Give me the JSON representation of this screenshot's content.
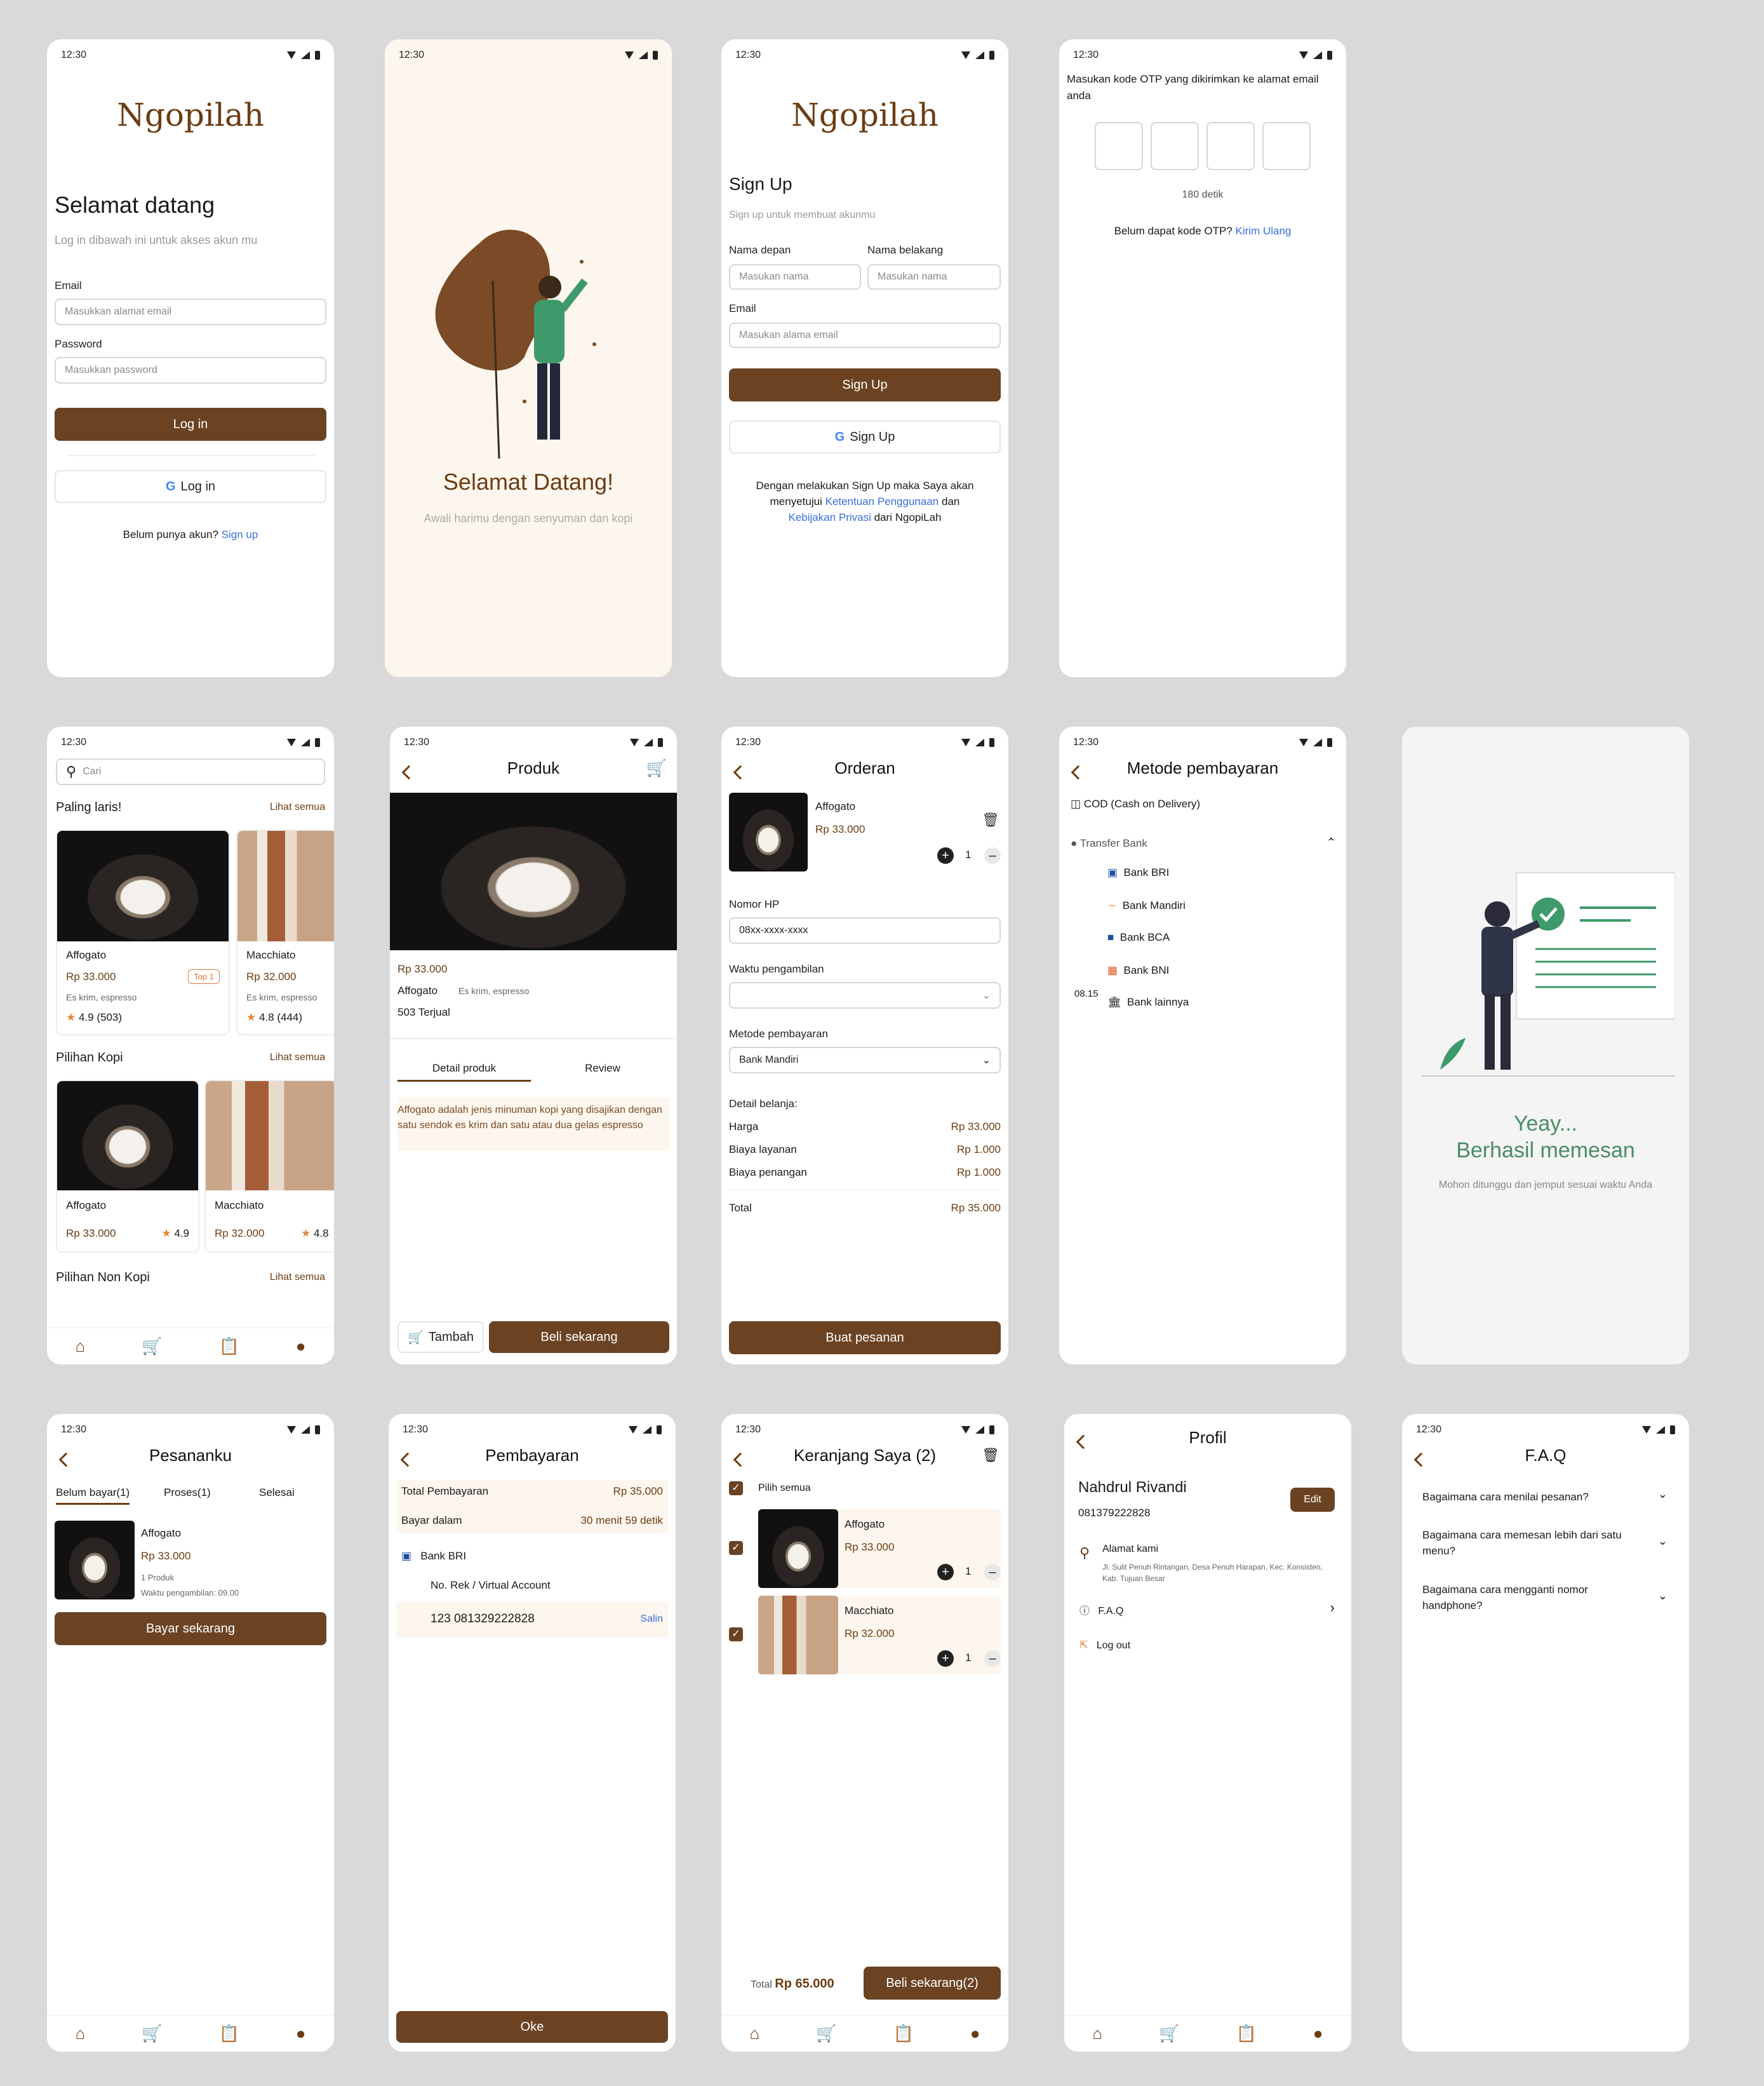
{
  "status": {
    "time": "12:30"
  },
  "login": {
    "logo": "Ngopilah",
    "title": "Selamat datang",
    "subtitle": "Log in dibawah ini untuk akses akun mu",
    "email_label": "Email",
    "email_placeholder": "Masukkan alamat email",
    "password_label": "Password",
    "password_placeholder": "Masukkan password",
    "login_btn": "Log in",
    "google_btn": "Log in",
    "no_account": "Belum punya akun?",
    "signup_link": "Sign up"
  },
  "splash": {
    "title": "Selamat Datang!",
    "subtitle": "Awali harimu dengan senyuman dan kopi"
  },
  "signup": {
    "logo": "Ngopilah",
    "title": "Sign Up",
    "subtitle": "Sign up untuk membuat akunmu",
    "first_label": "Nama depan",
    "first_placeholder": "Masukan nama",
    "last_label": "Nama belakang",
    "last_placeholder": "Masukan nama",
    "email_label": "Email",
    "email_placeholder": "Masukan alama email",
    "btn": "Sign Up",
    "google_btn": "Sign Up",
    "terms_1": "Dengan melakukan Sign Up maka Saya akan",
    "terms_2": "menyetujui",
    "terms_link1": "Ketentuan Penggunaan",
    "terms_3": "dan",
    "terms_link2": "Kebijakan Privasi",
    "terms_4": "dari NgopiLah"
  },
  "otp": {
    "instruction": "Masukan kode OTP yang dikirimkan ke alamat email anda",
    "timer": "180 detik",
    "resend_text": "Belum dapat kode OTP?",
    "resend_link": "Kirim Ulang"
  },
  "home": {
    "search_placeholder": "Cari",
    "section1": "Paling laris!",
    "section2": "Pilihan Kopi",
    "section3": "Pilihan Non Kopi",
    "see_all": "Lihat semua",
    "best": [
      {
        "name": "Affogato",
        "price": "Rp 33.000",
        "badge": "Top 1",
        "desc": "Es krim, espresso",
        "rating": "4.9 (503)"
      },
      {
        "name": "Macchiato",
        "price": "Rp 32.000",
        "desc": "Es krim, espresso",
        "rating": "4.8 (444)"
      }
    ],
    "coffee": [
      {
        "name": "Affogato",
        "price": "Rp 33.000",
        "rating": "4.9"
      },
      {
        "name": "Macchiato",
        "price": "Rp 32.000",
        "rating": "4.8"
      }
    ]
  },
  "product": {
    "title": "Produk",
    "price": "Rp 33.000",
    "name": "Affogato",
    "desc": "Es krim, espresso",
    "sold": "503 Terjual",
    "tab1": "Detail produk",
    "tab2": "Review",
    "detail": "Affogato adalah jenis minuman kopi yang disajikan dengan satu sendok es krim dan satu atau dua gelas espresso",
    "add": "Tambah",
    "buy": "Beli sekarang"
  },
  "order": {
    "title": "Orderan",
    "item_name": "Affogato",
    "item_price": "Rp 33.000",
    "qty": "1",
    "phone_label": "Nomor HP",
    "phone_value": "08xx-xxxx-xxxx",
    "time_label": "Waktu pengambilan",
    "time_value": "",
    "pay_label": "Metode pembayaran",
    "pay_value": "Bank Mandiri",
    "detail_label": "Detail belanja:",
    "rows": [
      {
        "k": "Harga",
        "v": "Rp 33.000"
      },
      {
        "k": "Biaya layanan",
        "v": "Rp 1.000"
      },
      {
        "k": "Biaya penangan",
        "v": "Rp 1.000"
      }
    ],
    "total_label": "Total",
    "total_value": "Rp 35.000",
    "btn": "Buat pesanan"
  },
  "payment_method": {
    "title": "Metode pembayaran",
    "cod": "COD (Cash on Delivery)",
    "transfer": "Transfer Bank",
    "banks": [
      "Bank BRI",
      "Bank Mandiri",
      "Bank BCA",
      "Bank BNI",
      "Bank lainnya"
    ],
    "time": "08.15"
  },
  "success": {
    "title1": "Yeay...",
    "title2": "Berhasil memesan",
    "subtitle": "Mohon ditunggu dan jemput sesuai waktu Anda"
  },
  "myorders": {
    "title": "Pesananku",
    "tab1": "Belum bayar(1)",
    "tab2": "Proses(1)",
    "tab3": "Selesai",
    "item_name": "Affogato",
    "item_price": "Rp 33.000",
    "item_qty": "1 Produk",
    "item_time": "Waktu pengambilan: 09.00",
    "btn": "Bayar sekarang"
  },
  "paying": {
    "title": "Pembayaran",
    "total_label": "Total Pembayaran",
    "total_value": "Rp 35.000",
    "within_label": "Bayar dalam",
    "within_value": "30 menit 59 detik",
    "bank": "Bank BRI",
    "va_label": "No. Rek / Virtual Account",
    "va_value": "123  081329222828",
    "copy": "Salin",
    "btn": "Oke"
  },
  "cart": {
    "title": "Keranjang Saya (2)",
    "select_all": "Pilih semua",
    "items": [
      {
        "name": "Affogato",
        "price": "Rp 33.000",
        "qty": "1"
      },
      {
        "name": "Macchiato",
        "price": "Rp 32.000",
        "qty": "1"
      }
    ],
    "total_label": "Total",
    "total_value": "Rp 65.000",
    "btn": "Beli sekarang(2)"
  },
  "profile": {
    "title": "Profil",
    "name": "Nahdrul Rivandi",
    "phone": "081379222828",
    "edit": "Edit",
    "address_label": "Alamat kami",
    "address": "Jl. Sulit Penuh Rintangan, Desa Penuh Harapan, Kec. Konsisten, Kab. Tujuan Besar",
    "faq": "F.A.Q",
    "logout": "Log out"
  },
  "faq": {
    "title": "F.A.Q",
    "q": [
      "Bagaimana cara menilai pesanan?",
      "Bagaimana cara memesan lebih dari satu menu?",
      "Bagaimana cara mengganti nomor handphone?"
    ]
  },
  "colors": {
    "brown": "#6b4323",
    "bg": "#d9d9d9",
    "green": "#4a8c66",
    "link": "#3a6fd8"
  }
}
